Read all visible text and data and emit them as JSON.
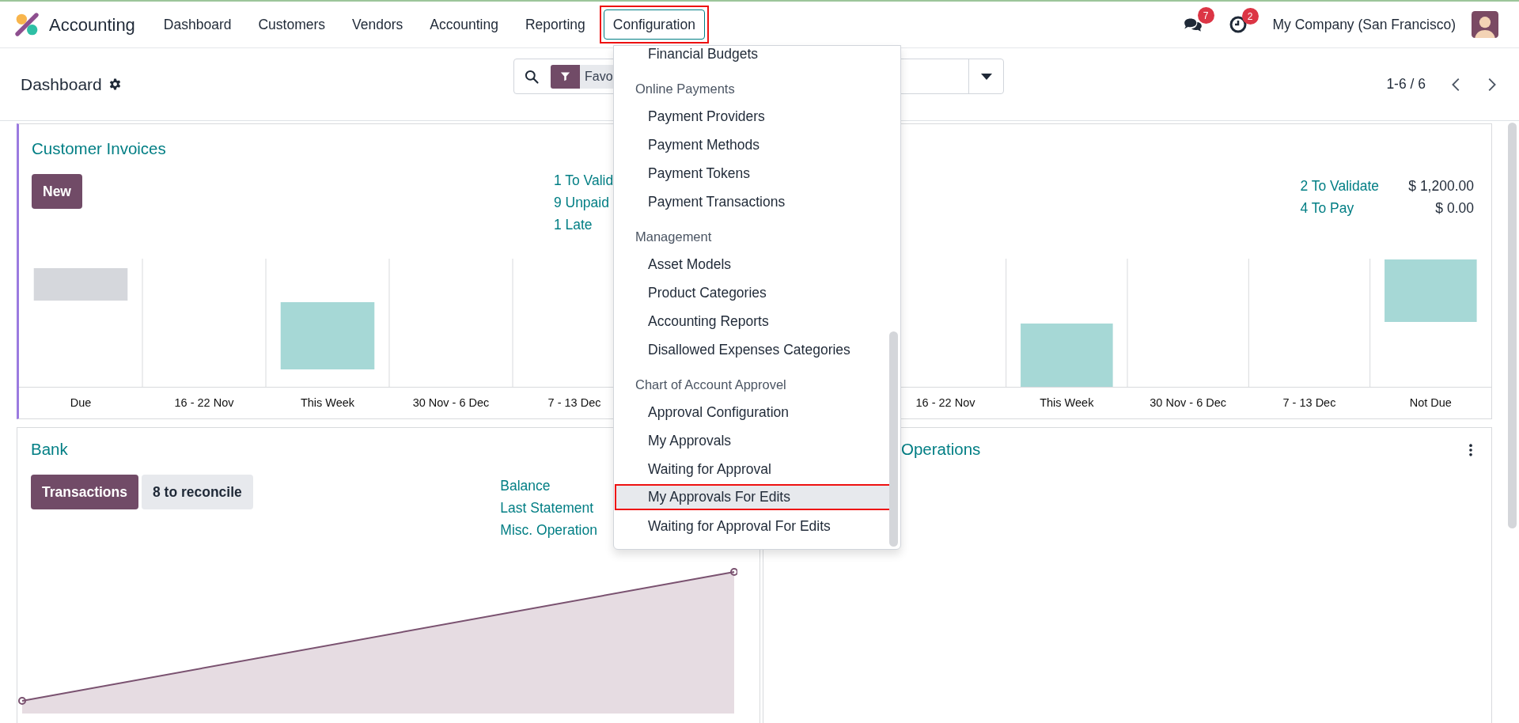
{
  "navbar": {
    "app_name": "Accounting",
    "menus": [
      {
        "label": "Dashboard",
        "selected": false,
        "highlighted": false
      },
      {
        "label": "Customers",
        "selected": false,
        "highlighted": false
      },
      {
        "label": "Vendors",
        "selected": false,
        "highlighted": false
      },
      {
        "label": "Accounting",
        "selected": false,
        "highlighted": false
      },
      {
        "label": "Reporting",
        "selected": false,
        "highlighted": false
      },
      {
        "label": "Configuration",
        "selected": true,
        "highlighted": true
      }
    ],
    "messages_count": "7",
    "activities_count": "2",
    "company": "My Company (San Francisco)"
  },
  "control_panel": {
    "title": "Dashboard",
    "search": {
      "facet": "Favo"
    },
    "pager": "1-6 / 6"
  },
  "dropdown": {
    "items": [
      {
        "kind": "item",
        "label": "Financial Budgets",
        "highlighted": false
      },
      {
        "kind": "header",
        "label": "Online Payments"
      },
      {
        "kind": "item",
        "label": "Payment Providers",
        "highlighted": false
      },
      {
        "kind": "item",
        "label": "Payment Methods",
        "highlighted": false
      },
      {
        "kind": "item",
        "label": "Payment Tokens",
        "highlighted": false
      },
      {
        "kind": "item",
        "label": "Payment Transactions",
        "highlighted": false
      },
      {
        "kind": "header",
        "label": "Management"
      },
      {
        "kind": "item",
        "label": "Asset Models",
        "highlighted": false
      },
      {
        "kind": "item",
        "label": "Product Categories",
        "highlighted": false
      },
      {
        "kind": "item",
        "label": "Accounting Reports",
        "highlighted": false
      },
      {
        "kind": "item",
        "label": "Disallowed Expenses Categories",
        "highlighted": false
      },
      {
        "kind": "header",
        "label": "Chart of Account Approvel"
      },
      {
        "kind": "item",
        "label": "Approval Configuration",
        "highlighted": false
      },
      {
        "kind": "item",
        "label": "My Approvals",
        "highlighted": false
      },
      {
        "kind": "item",
        "label": "Waiting for Approval",
        "highlighted": false
      },
      {
        "kind": "item",
        "label": "My Approvals For Edits",
        "highlighted": true
      },
      {
        "kind": "item",
        "label": "Waiting for Approval For Edits",
        "highlighted": false
      }
    ]
  },
  "invoices_card": {
    "title": "Customer Invoices",
    "color": "#9b7be0",
    "button": "New",
    "stats": [
      "1 To Valid",
      "9 Unpaid",
      "1 Late"
    ],
    "chart_labels": [
      "Due",
      "16 - 22 Nov",
      "This Week",
      "30 Nov - 6 Dec",
      "7 - 13 Dec"
    ]
  },
  "bills_card": {
    "stats": [
      {
        "label": "2 To Validate",
        "amount": "$ 1,200.00"
      },
      {
        "label": "4 To Pay",
        "amount": "$ 0.00"
      }
    ],
    "chart_labels": [
      "16 - 22 Nov",
      "This Week",
      "30 Nov - 6 Dec",
      "7 - 13 Dec",
      "Not Due"
    ]
  },
  "bank_card": {
    "title": "Bank",
    "buttons": [
      {
        "label": "Transactions",
        "kind": "primary"
      },
      {
        "label": "8 to reconcile",
        "kind": "secondary"
      }
    ],
    "stats": [
      "Balance",
      "Last Statement",
      "Misc. Operation"
    ]
  },
  "misc_card": {
    "title": "Operations"
  }
}
